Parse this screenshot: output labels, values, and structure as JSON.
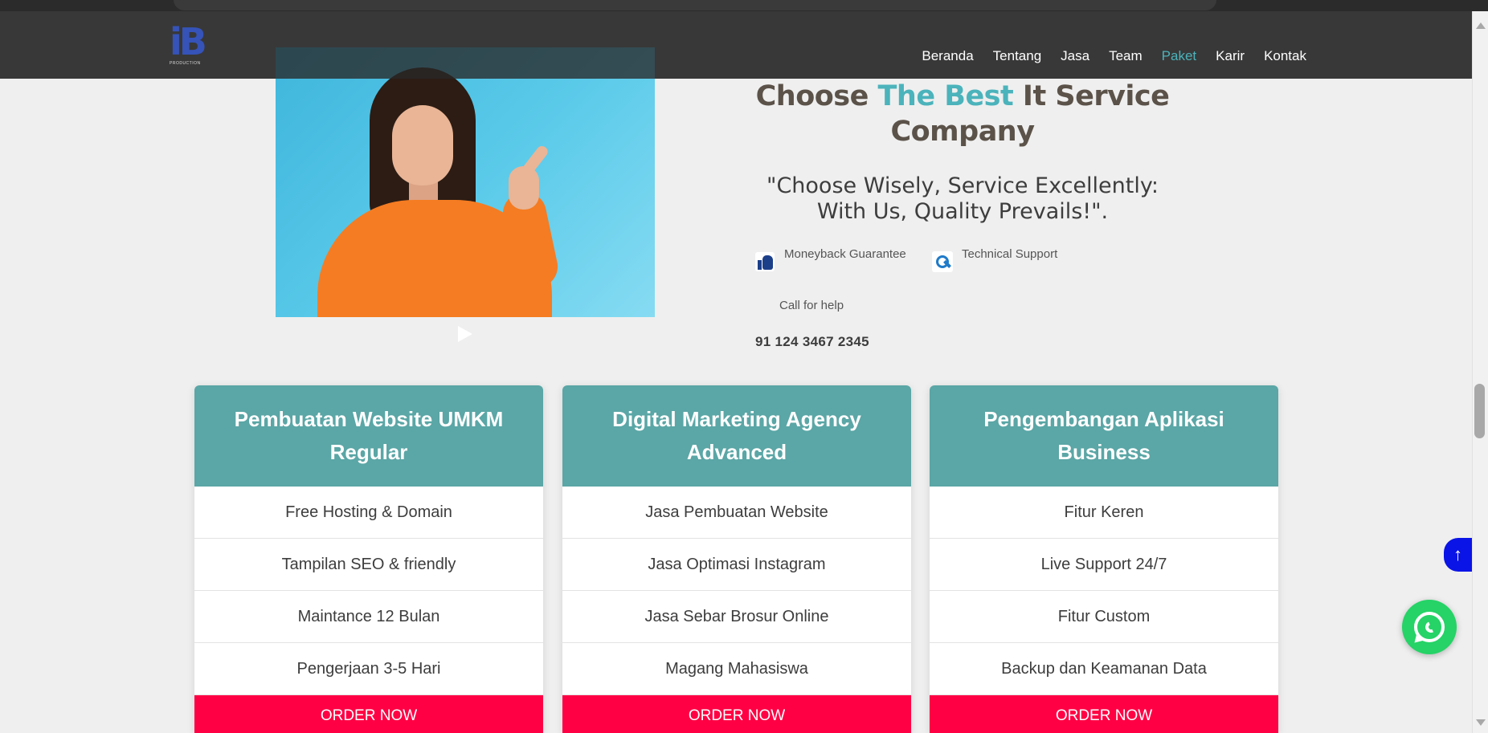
{
  "navbar": {
    "logo_mark": "iB",
    "logo_sub": "PRODUCTION",
    "links": [
      "Beranda",
      "Tentang",
      "Jasa",
      "Team",
      "Paket",
      "Karir",
      "Kontak"
    ],
    "active_link": "Paket",
    "accent_color": "#4bb3bb"
  },
  "hero": {
    "title_part1": "Choose ",
    "title_accent": "The Best",
    "title_part2": " It Service Company",
    "quote_line1": "\"Choose Wisely, Service Excellently:",
    "quote_line2": "With Us, Quality Prevails!\".",
    "features": [
      {
        "icon": "thumbs-up-icon",
        "label": "Moneyback Guarantee"
      },
      {
        "icon": "wrench-icon",
        "label": "Technical Support"
      }
    ],
    "call_label": "Call for help",
    "call_number": "91 124 3467 2345"
  },
  "cards": [
    {
      "title": "Pembuatan Website UMKM Regular",
      "items": [
        "Free Hosting & Domain",
        "Tampilan SEO & friendly",
        "Maintance 12 Bulan",
        "Pengerjaan 3-5 Hari"
      ],
      "button": "ORDER NOW"
    },
    {
      "title": "Digital Marketing Agency Advanced",
      "items": [
        "Jasa Pembuatan Website",
        "Jasa Optimasi Instagram",
        "Jasa Sebar Brosur Online",
        "Magang Mahasiswa"
      ],
      "button": "ORDER NOW"
    },
    {
      "title": "Pengembangan Aplikasi Business",
      "items": [
        "Fitur Keren",
        "Live Support 24/7",
        "Fitur Custom",
        "Backup dan Keamanan Data"
      ],
      "button": "ORDER NOW"
    }
  ],
  "colors": {
    "card_header": "#5ba6a6",
    "order_button": "#ff0044",
    "back_to_top": "#0a14e6",
    "whatsapp": "#25d366"
  }
}
